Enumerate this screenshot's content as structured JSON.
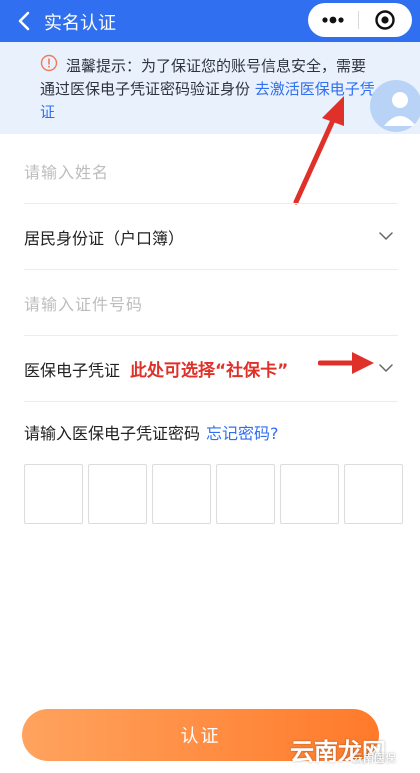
{
  "header": {
    "title": "实名认证",
    "back_icon": "chevron-left-icon",
    "more_icon": "more-dots-icon",
    "close_icon": "target-close-icon",
    "bar_color": "#2f6ff0"
  },
  "notice": {
    "text": "温馨提示：为了保证您的账号信息安全，需要通过医保电子凭证密码验证身份",
    "link_text": "去激活医保电子凭证",
    "icon": "info-circle-icon",
    "background": "#e9f1fd"
  },
  "form": {
    "name_placeholder": "请输入姓名",
    "id_type_value": "居民身份证（户口簿）",
    "id_number_placeholder": "请输入证件号码",
    "credential_type_value": "医保电子凭证",
    "annotation": "此处可选择“社保卡”",
    "password_label": "请输入医保电子凭证密码",
    "forgot_link": "忘记密码?",
    "pin_count": 6
  },
  "submit": {
    "label": "认证",
    "color": "#ff8a3c"
  },
  "watermark": {
    "main": "云南龙网",
    "small": "云南医保"
  }
}
